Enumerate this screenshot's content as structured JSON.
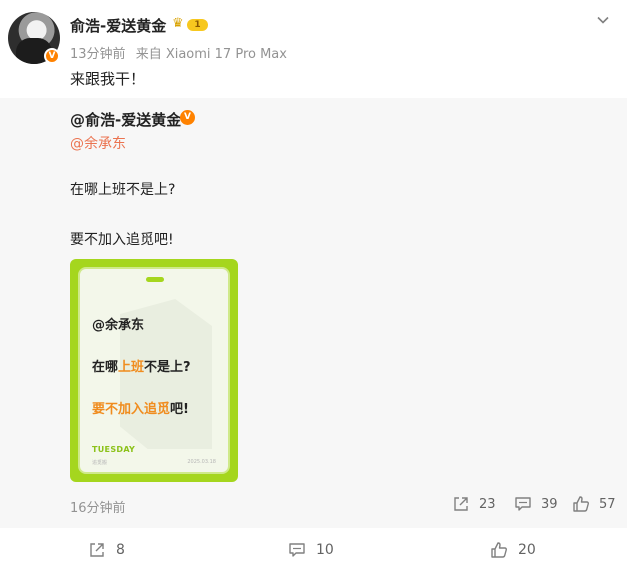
{
  "post": {
    "username": "俞浩-爱送黄金",
    "rank_level": "1",
    "time": "13分钟前",
    "source": "来自 Xiaomi 17 Pro Max",
    "text": "来跟我干！"
  },
  "repost": {
    "username": "@俞浩-爱送黄金",
    "mention": "@余承东",
    "line1": "在哪上班不是上?",
    "line2": "要不加入追觅吧!",
    "image": {
      "mention": "@余承东",
      "l1_pre": "在哪",
      "l1_hl": "上班",
      "l1_post": "不是上?",
      "l2_hl": "要不加入追觅",
      "l2_post": "吧!",
      "day": "TUESDAY",
      "sub": "追觅搬",
      "date": "2025.03.18",
      "colors": {
        "frame": "#a5d61e",
        "highlight": "#f08c1e"
      }
    },
    "time": "16分钟前",
    "actions": {
      "repost": "23",
      "comment": "39",
      "like": "57"
    }
  },
  "actions": {
    "repost": "8",
    "comment": "10",
    "like": "20"
  },
  "icons": {
    "verified": "v-badge-icon",
    "crown": "crown-icon",
    "collapse": "chevron-down-icon",
    "repost": "share-icon",
    "comment": "comment-icon",
    "like": "thumbs-up-icon"
  },
  "colors": {
    "accent": "#ff8200",
    "mention": "#eb7350",
    "meta": "#939393"
  }
}
